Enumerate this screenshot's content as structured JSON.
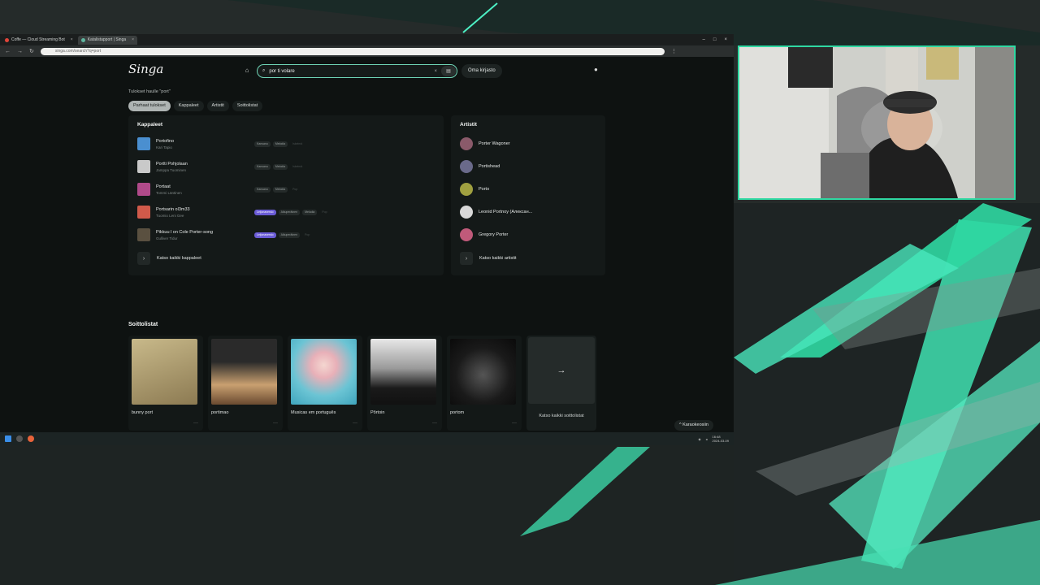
{
  "browser": {
    "tabs": [
      {
        "label": "Coffe — Cloud Streaming Bot"
      },
      {
        "label": "Katalistapport | Singa"
      }
    ],
    "url": "singa.com/search?q=port"
  },
  "app": {
    "logo": "Singa",
    "search": {
      "value": "por ti volare"
    },
    "library_label": "Oma kirjasto",
    "results_title": "Tulokset haulle \"port\"",
    "filters": [
      {
        "label": "Parhaat tulokset",
        "active": true
      },
      {
        "label": "Kappaleet",
        "active": false
      },
      {
        "label": "Artistit",
        "active": false
      },
      {
        "label": "Soittolistat",
        "active": false
      }
    ],
    "songs_panel": {
      "title": "Kappaleet",
      "songs": [
        {
          "name": "Portofino",
          "artist": "Kari Tapio",
          "color": "#4a8fd0",
          "tags": [
            "Kansanu",
            "Melodia",
            "Iskelmä"
          ]
        },
        {
          "name": "Portti Pohjolaan",
          "artist": "Jamppa Tuominen",
          "color": "#c9c9c9",
          "tags": [
            "Kansanu",
            "Melodia",
            "Iskelmä"
          ]
        },
        {
          "name": "Portaat",
          "artist": "Tommi Läntinen",
          "color": "#b04a8a",
          "tags": [
            "Kansanu",
            "Melodia",
            "Pop"
          ]
        },
        {
          "name": "Portsarin ol3m33",
          "artist": "Tuomio Leni Gee",
          "color": "#d05a4a",
          "tags": [
            "Leijonaversio",
            "Alkuperäinen",
            "Melodia",
            "Pop"
          ]
        },
        {
          "name": "Pikkuu l on Cole Porter-song",
          "artist": "Gulliver Tidur",
          "color": "#5a5040",
          "tags": [
            "Leijonaversio",
            "Alkuperäinen",
            "Pop"
          ]
        }
      ],
      "see_all": "Katso kaikki kappaleet"
    },
    "artists_panel": {
      "title": "Artistit",
      "artists": [
        {
          "name": "Porter Wagoner",
          "color": "#8a5a6a"
        },
        {
          "name": "Portishead",
          "color": "#6a6a8a"
        },
        {
          "name": "Porto",
          "color": "#a0a040"
        },
        {
          "name": "Leonid Portnoy (Алексан...",
          "color": "#d8d8d8"
        },
        {
          "name": "Gregory Porter",
          "color": "#c05a7a"
        }
      ],
      "see_all": "Katso kaikki artistit"
    },
    "playlists_title": "Soittolistat",
    "playlists": [
      {
        "name": "bunny port"
      },
      {
        "name": "portimao"
      },
      {
        "name": "Musicas em português"
      },
      {
        "name": "Pôrtoin"
      },
      {
        "name": "portom"
      }
    ],
    "playlists_see_all": "Katso kaikki soittolistat",
    "karaoke_label": "Karaokeosiin"
  },
  "taskbar": {
    "time": "16:48",
    "date": "2024-03-09"
  }
}
